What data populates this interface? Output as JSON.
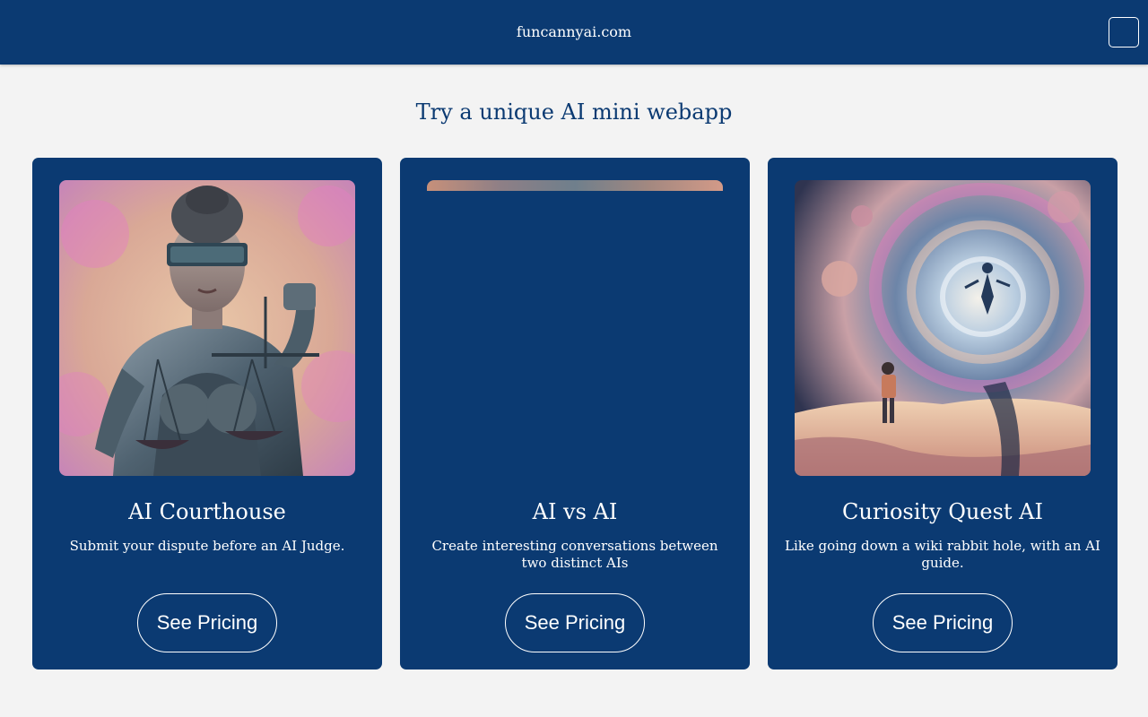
{
  "header": {
    "brand": "funcannyai.com",
    "menu_icon": "menu-icon"
  },
  "main": {
    "headline": "Try a unique AI mini webapp",
    "cards": [
      {
        "title": "AI Courthouse",
        "description": "Submit your dispute before an AI Judge.",
        "button_label": "See Pricing",
        "image": "robot-lady-justice-illustration"
      },
      {
        "title": "AI vs AI",
        "description": "Create interesting conversations between two distinct AIs",
        "button_label": "See Pricing",
        "image": "image-loading-partial"
      },
      {
        "title": "Curiosity Quest AI",
        "description": "Like going down a wiki rabbit hole, with an AI guide.",
        "button_label": "See Pricing",
        "image": "cosmic-vortex-explorer-illustration"
      }
    ]
  },
  "colors": {
    "brand_navy": "#0b3a72",
    "page_background": "#f3f3f3",
    "text_on_navy": "#ffffff"
  }
}
